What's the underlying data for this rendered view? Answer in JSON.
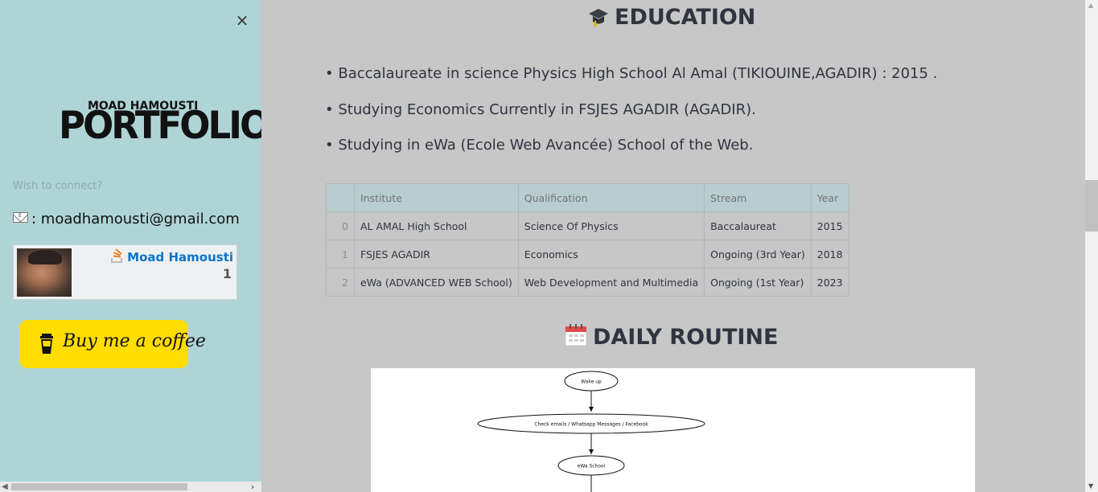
{
  "sidebar": {
    "logo_top": "MOAD HAMOUSTI",
    "logo_main": "PORTFOLIO",
    "connect_label": "Wish to connect?",
    "email": ": moadhamousti@gmail.com",
    "stackoverflow": {
      "name": "Moad Hamousti",
      "reputation": "1"
    },
    "coffee_label": "Buy me a coffee",
    "close_icon": "×"
  },
  "education": {
    "title": "EDUCATION",
    "bullets": [
      "• Baccalaureate in science Physics High School Al Amal (TIKIOUINE,AGADIR) : 2015 .",
      "• Studying Economics Currently in FSJES AGADIR (AGADIR).",
      "• Studying in eWa (Ecole Web Avancée) School of the Web."
    ],
    "table": {
      "headers": [
        "",
        "Institute",
        "Qualification",
        "Stream",
        "Year"
      ],
      "rows": [
        [
          "0",
          "AL AMAL High School",
          "Science Of Physics",
          "Baccalaureat",
          "2015"
        ],
        [
          "1",
          "FSJES AGADIR",
          "Economics",
          "Ongoing (3rd Year)",
          "2018"
        ],
        [
          "2",
          "eWa (ADVANCED WEB School)",
          "Web Development and Multimedia",
          "Ongoing (1st Year)",
          "2023"
        ]
      ]
    }
  },
  "routine": {
    "title": "DAILY ROUTINE",
    "nodes": [
      "Wake up",
      "Check emails / Whatsapp Messages / Facebook",
      "eWa School"
    ]
  },
  "colors": {
    "sidebar_bg": "#afd4d5",
    "main_bg": "#c6c7c6",
    "coffee_yellow": "#ffdd00",
    "so_blue": "#0a74c9"
  }
}
